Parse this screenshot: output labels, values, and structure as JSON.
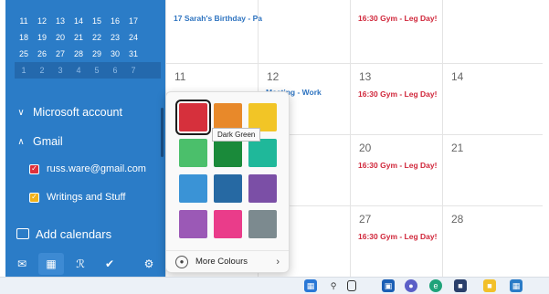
{
  "colors": {
    "sidebar": "#2b7cc7",
    "event_red": "#d0263a",
    "event_blue": "#2f74c0"
  },
  "mini_calendar": {
    "weeks": [
      [
        "11",
        "12",
        "13",
        "14",
        "15",
        "16",
        "17"
      ],
      [
        "18",
        "19",
        "20",
        "21",
        "22",
        "23",
        "24"
      ],
      [
        "25",
        "26",
        "27",
        "28",
        "29",
        "30",
        "31"
      ],
      [
        "1",
        "2",
        "3",
        "4",
        "5",
        "6",
        "7"
      ]
    ]
  },
  "sidebar": {
    "microsoft_account": {
      "label": "Microsoft account",
      "chevron": "chevron-down-icon"
    },
    "gmail": {
      "label": "Gmail",
      "chevron": "chevron-up-icon"
    },
    "calendars": [
      {
        "label": "russ.ware@gmail.com",
        "color": "#e0303a",
        "checked": true
      },
      {
        "label": "Writings and Stuff",
        "color": "#f2b21a",
        "checked": true
      }
    ],
    "add_calendars": "Add calendars"
  },
  "bottom_bar": {
    "icons": [
      "mail-icon",
      "calendar-icon",
      "people-icon",
      "todo-icon",
      "settings-icon"
    ]
  },
  "calendar": {
    "events": {
      "birthday": "17 Sarah's Birthday - Pa",
      "gym": "16:30 Gym - Leg Day!",
      "meeting": "Meeting - Work"
    },
    "days": {
      "d11": "11",
      "d12": "12",
      "d13": "13",
      "d14": "14",
      "d20": "20",
      "d21": "21",
      "d27": "27",
      "d28": "28"
    }
  },
  "color_picker": {
    "swatches": [
      "#d6303c",
      "#e8892a",
      "#f2c526",
      "#4bbf6b",
      "#1a8a3a",
      "#1fb89a",
      "#3a93d6",
      "#2669a3",
      "#7b4fa6",
      "#9b59b6",
      "#ea3c8a",
      "#7c8a8f"
    ],
    "selected_index": 0,
    "tooltip": "Dark Green",
    "more_colours": "More Colours"
  },
  "taskbar": {
    "icons": [
      "start-icon",
      "search-icon",
      "taskview-icon",
      "widgets-icon",
      "chat-icon",
      "edge-icon",
      "store-icon",
      "files-icon",
      "calendar-app-icon"
    ]
  }
}
